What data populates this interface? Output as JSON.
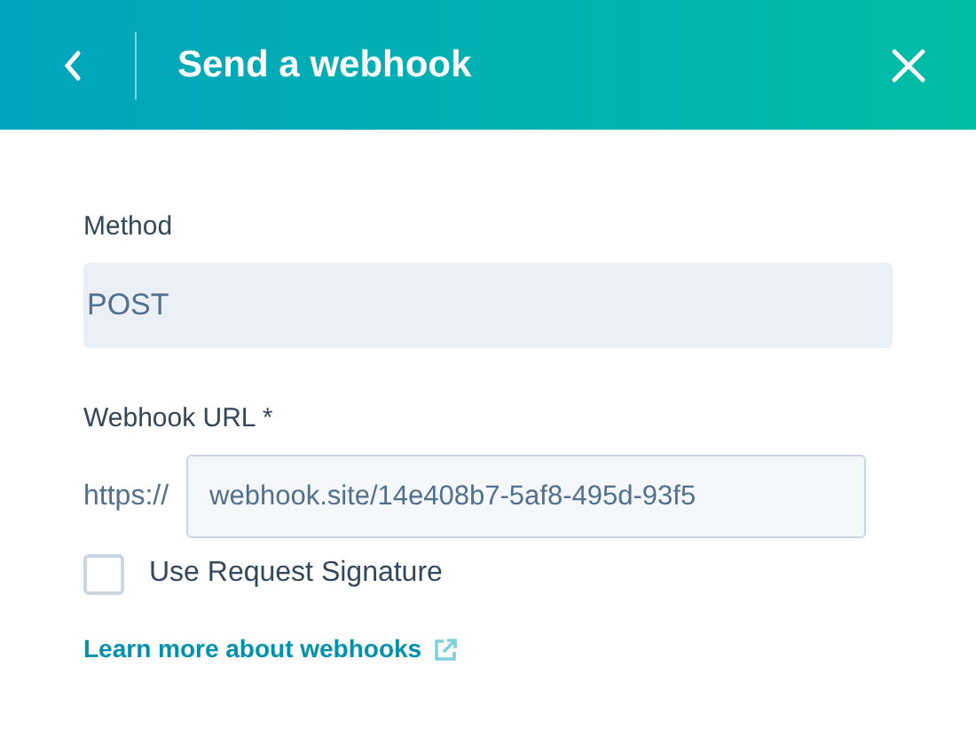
{
  "header": {
    "title": "Send a webhook"
  },
  "method": {
    "label": "Method",
    "value": "POST"
  },
  "webhook_url": {
    "label": "Webhook URL *",
    "prefix": "https://",
    "value": "webhook.site/14e408b7-5af8-495d-93f5"
  },
  "request_signature": {
    "label": "Use Request Signature",
    "checked": false
  },
  "link": {
    "text": "Learn more about webhooks"
  }
}
